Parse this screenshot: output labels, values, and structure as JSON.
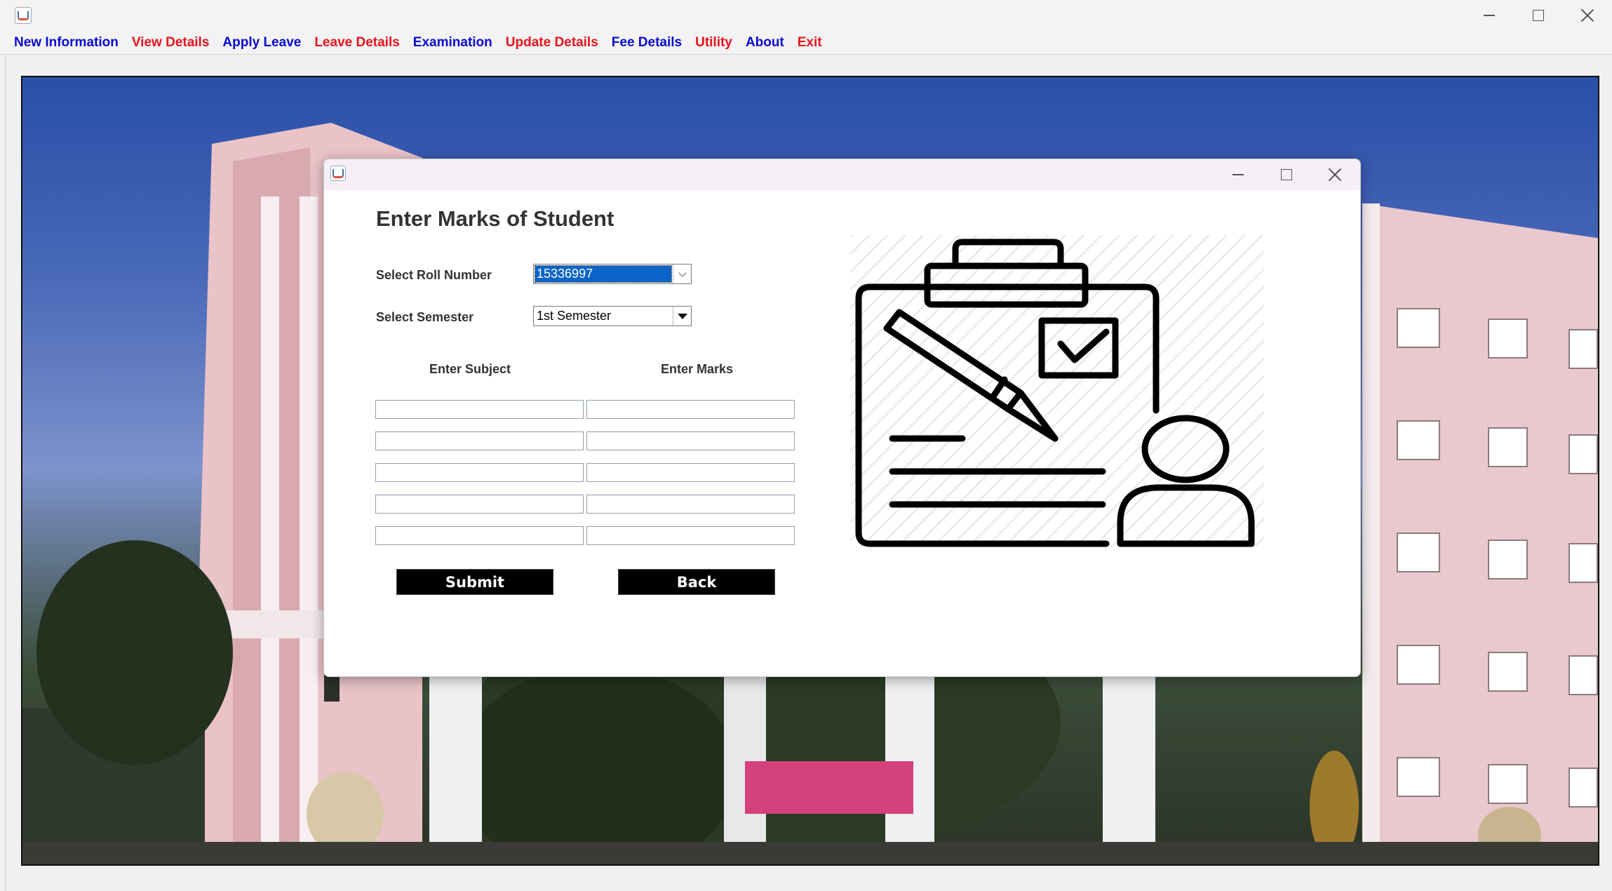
{
  "window": {
    "icon": "java-coffee-icon",
    "controls": [
      "minimize-icon",
      "maximize-icon",
      "close-icon"
    ]
  },
  "menu": {
    "items": [
      {
        "label": "New Information",
        "color": "#0a0ad2"
      },
      {
        "label": "View Details",
        "color": "#e8121d"
      },
      {
        "label": "Apply Leave",
        "color": "#0a0ad2"
      },
      {
        "label": "Leave Details",
        "color": "#e8121d"
      },
      {
        "label": "Examination",
        "color": "#0a0ad2"
      },
      {
        "label": "Update Details",
        "color": "#e8121d"
      },
      {
        "label": "Fee Details",
        "color": "#0a0ad2"
      },
      {
        "label": "Utility",
        "color": "#e8121d"
      },
      {
        "label": "About",
        "color": "#0a0ad2"
      },
      {
        "label": "Exit",
        "color": "#e8121d"
      }
    ]
  },
  "dialog": {
    "title": "Enter Marks of Student",
    "roll_label": "Select Roll Number",
    "roll_value": "15336997",
    "semester_label": "Select Semester",
    "semester_value": "1st Semester",
    "subject_header": "Enter Subject",
    "marks_header": "Enter Marks",
    "rows": [
      {
        "subject": "",
        "marks": ""
      },
      {
        "subject": "",
        "marks": ""
      },
      {
        "subject": "",
        "marks": ""
      },
      {
        "subject": "",
        "marks": ""
      },
      {
        "subject": "",
        "marks": ""
      }
    ],
    "submit_label": "Submit",
    "back_label": "Back",
    "illustration": "clipboard-exam-icon"
  },
  "background": {
    "image": "college-building-photo"
  }
}
